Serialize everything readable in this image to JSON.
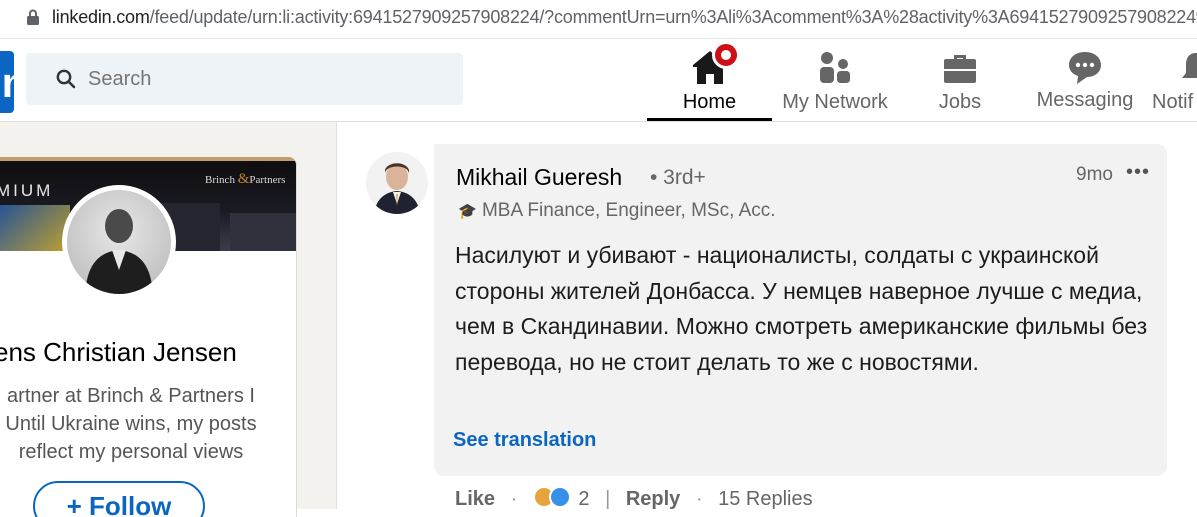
{
  "browser": {
    "url_host": "linkedin.com",
    "url_path": "/feed/update/urn:li:activity:6941527909257908224/?commentUrn=urn%3Ali%3Acomment%3A%28activity%3A6941527909257908224%"
  },
  "nav": {
    "search_placeholder": "Search",
    "items": [
      {
        "label": "Home",
        "icon": "home-icon",
        "active": true
      },
      {
        "label": "My Network",
        "icon": "network-icon"
      },
      {
        "label": "Jobs",
        "icon": "briefcase-icon"
      },
      {
        "label": "Messaging",
        "icon": "messaging-icon"
      },
      {
        "label": "Notif",
        "icon": "bell-icon"
      }
    ],
    "colors": {
      "brand": "#0a66c2",
      "badge": "#cc1016"
    }
  },
  "profile_card": {
    "banner_tag": "MIUM",
    "banner_brand_a": "Brinch",
    "banner_brand_amp": "&",
    "banner_brand_b": "Partners",
    "name": "ens Christian Jensen",
    "headline_lines": [
      "artner at Brinch & Partners I",
      "Until Ukraine wins, my posts",
      "reflect my personal views"
    ],
    "follow_label": "+ Follow"
  },
  "comment": {
    "author": "Mikhail Gueresh",
    "degree": "• 3rd+",
    "time": "9mo",
    "more": "•••",
    "headline": "MBA Finance, Engineer, MSc, Acc.",
    "text": "Насилуют и убивают - националисты, солдаты с украинской стороны жителей Донбасса. У немцев наверное лучше с медиа, чем в Скандинавии. Можно смотреть американские фильмы без перевода, но не стоит делать то же с новостями.",
    "see_translation": "See translation",
    "like_label": "Like",
    "dot": "·",
    "reaction_count": "2",
    "reply_label": "Reply",
    "replies_label": "15 Replies"
  }
}
